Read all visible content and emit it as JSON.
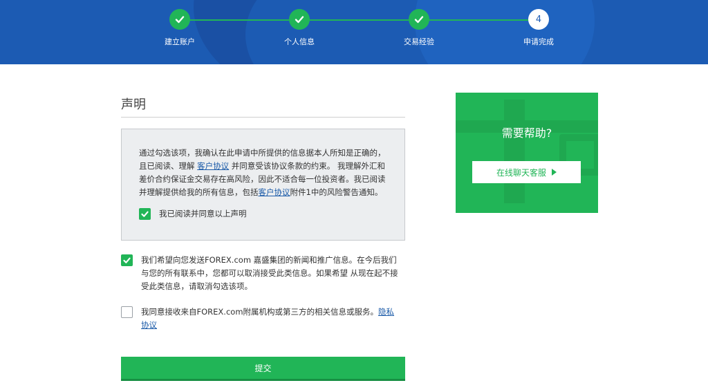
{
  "stepper": {
    "steps": [
      {
        "label": "建立账户",
        "status": "done"
      },
      {
        "label": "个人信息",
        "status": "done"
      },
      {
        "label": "交易经验",
        "status": "done"
      },
      {
        "label": "申请完成",
        "status": "current",
        "number": "4"
      }
    ]
  },
  "declaration": {
    "title": "声明",
    "text_part1": "通过勾选该项，我确认在此申请中所提供的信息据本人所知是正确的，且已阅读、理解 ",
    "link1": "客户协议",
    "text_part2": " 并同意受该协议条款的约束。 我理解外汇和差价合约保证金交易存在高风险，因此不适合每一位投资者。我已阅读并理解提供给我的所有信息，包括",
    "link2": "客户协议",
    "text_part3": "附件1中的风险警告通知。",
    "agree_label": "我已阅读并同意以上声明",
    "agree_checked": true
  },
  "marketing": {
    "label": "我们希望向您发送FOREX.com 嘉盛集团的新闻和推广信息。在今后我们与您的所有联系中，您都可以取消接受此类信息。如果希望 从现在起不接受此类信息，请取消勾选该项。",
    "checked": true
  },
  "third_party": {
    "label": "我同意接收来自FOREX.com附属机构或第三方的相关信息或服务。",
    "link": "隐私协议",
    "checked": false
  },
  "submit_label": "提交",
  "help": {
    "title": "需要帮助?",
    "chat_label": "在线聊天客服"
  },
  "colors": {
    "header_blue": "#1c5bb3",
    "accent_green": "#21b557",
    "link_blue": "#1a5aa8"
  }
}
